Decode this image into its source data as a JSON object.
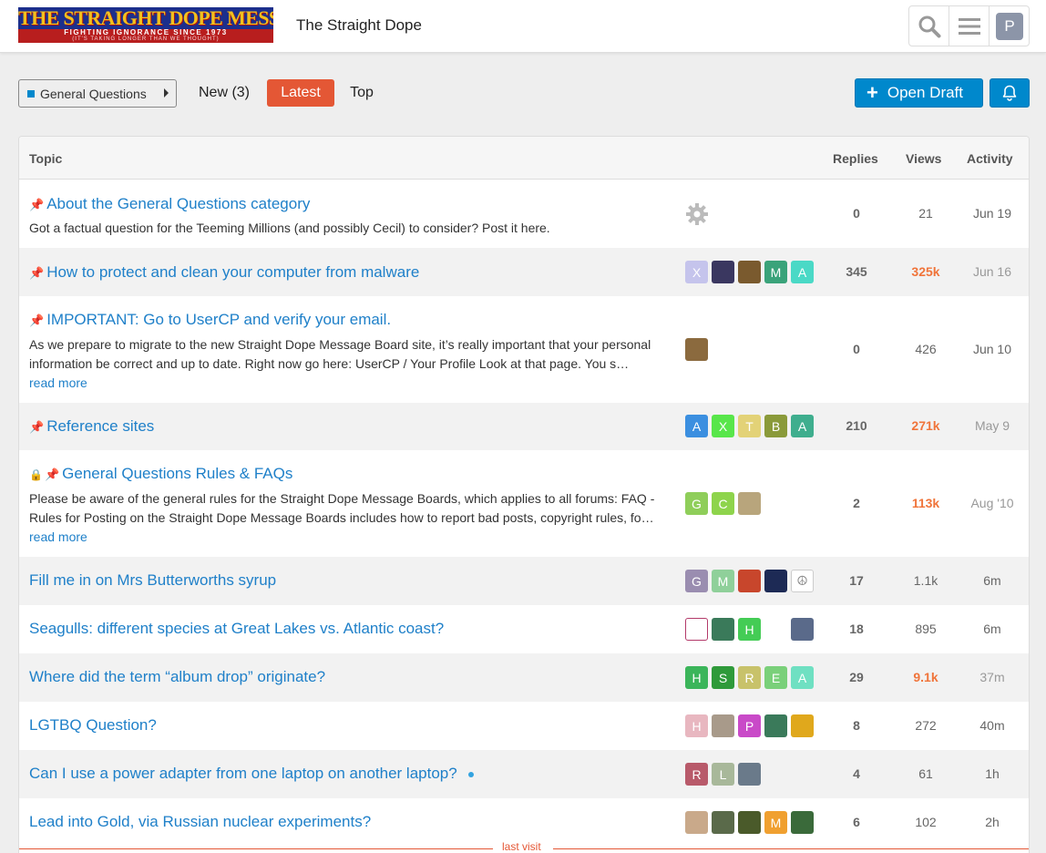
{
  "header": {
    "logo_line1": "THE STRAIGHT DOPE MESSAGE BOARD",
    "logo_line2": "FIGHTING IGNORANCE SINCE 1973",
    "logo_line3": "(IT'S TAKING LONGER THAN WE THOUGHT)",
    "site_title": "The Straight Dope",
    "user_initial": "P"
  },
  "nav": {
    "category": "General Questions",
    "category_color": "#0088cc",
    "tabs": {
      "new": "New (3)",
      "latest": "Latest",
      "top": "Top"
    },
    "open_draft": "Open Draft"
  },
  "table": {
    "headers": {
      "topic": "Topic",
      "replies": "Replies",
      "views": "Views",
      "activity": "Activity"
    },
    "rows": [
      {
        "title": "About the General Questions category",
        "excerpt": "Got a factual question for the Teeming Millions (and possibly Cecil) to consider? Post it here.",
        "replies": "0",
        "views": "21",
        "activity": "Jun 19"
      },
      {
        "title": "How to protect and clean your computer from malware",
        "replies": "345",
        "views": "325k",
        "activity": "Jun 16",
        "posters": [
          "X",
          "",
          "",
          "M",
          "A"
        ]
      },
      {
        "title": "IMPORTANT: Go to UserCP and verify your email.",
        "excerpt": "As we prepare to migrate to the new Straight Dope Message Board site, it’s really important that your personal information be correct and up to date. Right now go here: UserCP / Your Profile Look at that page. You s…",
        "read_more": "read more",
        "replies": "0",
        "views": "426",
        "activity": "Jun 10"
      },
      {
        "title": "Reference sites",
        "replies": "210",
        "views": "271k",
        "activity": "May 9",
        "posters": [
          "A",
          "X",
          "T",
          "B",
          "A"
        ]
      },
      {
        "title": "General Questions Rules & FAQs",
        "excerpt": "Please be aware of the general rules for the Straight Dope Message Boards, which applies to all forums: FAQ - Rules for Posting on the Straight Dope Message Boards includes how to report bad posts, copyright rules, fo…",
        "read_more": "read more",
        "replies": "2",
        "views": "113k",
        "activity": "Aug '10",
        "posters": [
          "G",
          "C",
          ""
        ]
      },
      {
        "title": "Fill me in on Mrs Butterworths syrup",
        "replies": "17",
        "views": "1.1k",
        "activity": "6m",
        "posters": [
          "G",
          "M",
          "",
          "",
          ""
        ]
      },
      {
        "title": "Seagulls: different species at Great Lakes vs. Atlantic coast?",
        "replies": "18",
        "views": "895",
        "activity": "6m",
        "posters": [
          "",
          "",
          "H",
          "",
          ""
        ]
      },
      {
        "title": "Where did the term “album drop” originate?",
        "replies": "29",
        "views": "9.1k",
        "activity": "37m",
        "posters": [
          "H",
          "S",
          "R",
          "E",
          "A"
        ]
      },
      {
        "title": "LGTBQ Question?",
        "replies": "8",
        "views": "272",
        "activity": "40m",
        "posters": [
          "H",
          "",
          "P",
          "",
          ""
        ]
      },
      {
        "title": "Can I use a power adapter from one laptop on another laptop?",
        "replies": "4",
        "views": "61",
        "activity": "1h",
        "posters": [
          "R",
          "L",
          ""
        ]
      },
      {
        "title": "Lead into Gold, via Russian nuclear experiments?",
        "replies": "6",
        "views": "102",
        "activity": "2h",
        "posters": [
          "",
          "",
          "",
          "M",
          ""
        ]
      }
    ]
  },
  "last_visit": "last visit"
}
